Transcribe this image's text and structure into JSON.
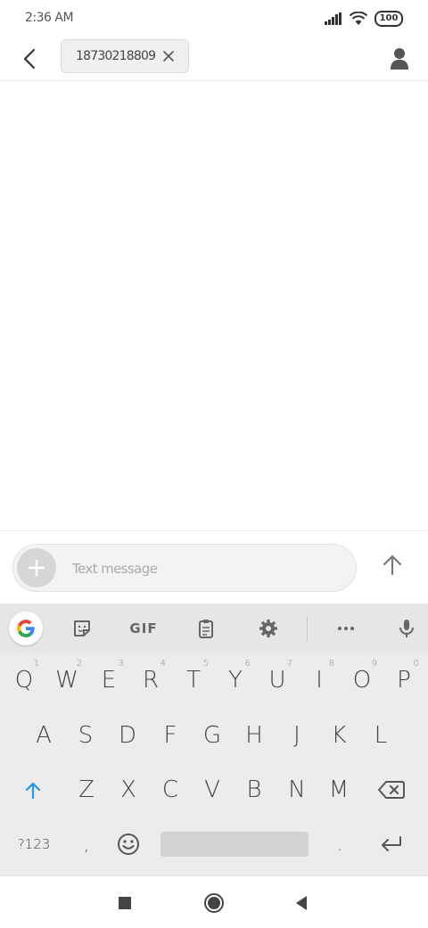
{
  "status_bar": {
    "time": "2:36 AM",
    "battery": "100",
    "icons": [
      "signal-icon",
      "wifi-icon",
      "battery-icon"
    ]
  },
  "header": {
    "recipient": "18730218809",
    "icons": [
      "back-arrow-icon",
      "close-icon",
      "person-icon"
    ]
  },
  "compose": {
    "placeholder": "Text message",
    "icons": [
      "plus-icon",
      "send-arrow-icon"
    ]
  },
  "keyboard": {
    "toolbar": {
      "gif_label": "GIF",
      "icons": [
        "google-icon",
        "sticker-icon",
        "clipboard-icon",
        "gear-icon",
        "more-icon",
        "mic-icon"
      ]
    },
    "row1": [
      "Q",
      "W",
      "E",
      "R",
      "T",
      "Y",
      "U",
      "I",
      "O",
      "P"
    ],
    "row1_hints": [
      "1",
      "2",
      "3",
      "4",
      "5",
      "6",
      "7",
      "8",
      "9",
      "0"
    ],
    "row2": [
      "A",
      "S",
      "D",
      "F",
      "G",
      "H",
      "J",
      "K",
      "L"
    ],
    "row3": [
      "Z",
      "X",
      "C",
      "V",
      "B",
      "N",
      "M"
    ],
    "bottom": {
      "symbols": "?123",
      "comma": ",",
      "period": "."
    },
    "colors": {
      "accent": "#2196F3",
      "key_bg": "#ececec",
      "toolbar_bg": "#e6e6e6"
    }
  },
  "nav_bar": {
    "icons": [
      "recent-apps-icon",
      "home-icon",
      "back-icon"
    ]
  }
}
